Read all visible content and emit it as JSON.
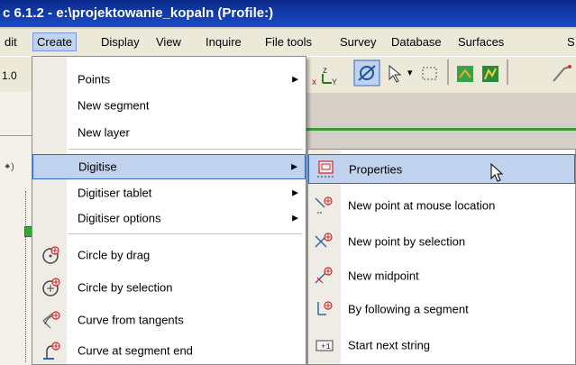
{
  "window": {
    "title": "c 6.1.2 - e:\\projektowanie_kopaln (Profile:)"
  },
  "menubar": [
    "dit",
    "Create",
    "Display",
    "View",
    "Inquire",
    "File tools",
    "Survey",
    "Database",
    "Surfaces",
    "S"
  ],
  "toolbar": {
    "zoom_text": "1.0"
  },
  "create_menu": {
    "items": [
      {
        "label": "Points",
        "submenu": true,
        "icon": ""
      },
      {
        "label": "New segment",
        "submenu": false,
        "icon": ""
      },
      {
        "label": "New layer",
        "submenu": false,
        "icon": ""
      },
      {
        "label": "Digitise",
        "submenu": true,
        "icon": "",
        "selected": true
      },
      {
        "label": "Digitiser tablet",
        "submenu": true,
        "icon": ""
      },
      {
        "label": "Digitiser options",
        "submenu": true,
        "icon": ""
      },
      {
        "label": "Circle by drag",
        "submenu": false,
        "icon": "circle-drag-icon"
      },
      {
        "label": "Circle by selection",
        "submenu": false,
        "icon": "circle-selection-icon"
      },
      {
        "label": "Curve from tangents",
        "submenu": false,
        "icon": "curve-tangents-icon"
      },
      {
        "label": "Curve at segment end",
        "submenu": false,
        "icon": "curve-segment-end-icon"
      }
    ]
  },
  "digitise_submenu": {
    "items": [
      {
        "label": "Properties",
        "icon": "properties-icon",
        "selected": true
      },
      {
        "label": "New point at mouse location",
        "icon": "point-mouse-icon"
      },
      {
        "label": "New point by selection",
        "icon": "point-selection-icon"
      },
      {
        "label": "New midpoint",
        "icon": "midpoint-icon"
      },
      {
        "label": "By following a segment",
        "icon": "follow-segment-icon"
      },
      {
        "label": "Start next string",
        "icon": "next-string-icon"
      }
    ]
  },
  "colors": {
    "selection": "#c1d2ee",
    "selection_border": "#316ac5",
    "titlebar": "#0a2a8a"
  }
}
